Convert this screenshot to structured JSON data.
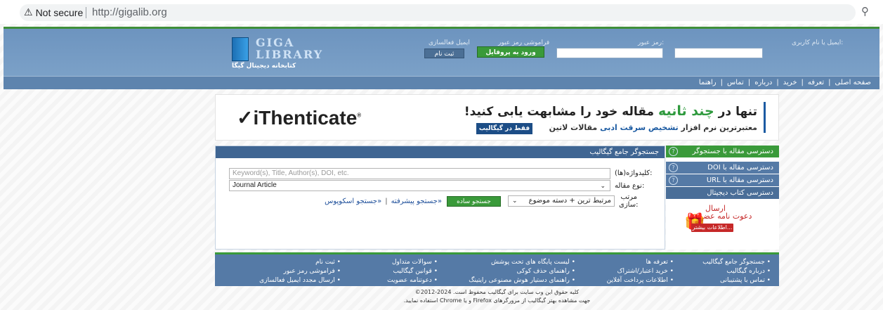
{
  "browser": {
    "security": "Not secure",
    "url": "http://gigalib.org"
  },
  "header": {
    "logo_top": "GIGA",
    "logo_bottom": "LIBRARY",
    "logo_tagline": "کتابخانه دیجیتال گیگا",
    "email_label": "ایمیل یا نام کاربری:",
    "password_label": "رمز عبور:",
    "forgot_password": "فراموشی رمز عبور",
    "email_activation": "ایمیل فعالسازی",
    "login_button": "ورود به پروفایل",
    "signup_button": "ثبت نام"
  },
  "nav": {
    "items": [
      "صفحه اصلی",
      "تعرفه",
      "خرید",
      "درباره",
      "تماس",
      "راهنما"
    ]
  },
  "banner": {
    "brand": "iThenticate",
    "line1_pre": "تنها در",
    "line1_hl": "چند ثانیه",
    "line1_post": "مقاله خود را مشابهت یابی کنید!",
    "line2_pre": "معتبرترین نرم افزار",
    "line2_hl": "تشخیص سرقت ادبی",
    "line2_post": "مقالات لاتین",
    "cta": "فقط در گیگالیب"
  },
  "search": {
    "title": "جستجوگر جامع گیگالیب",
    "keyword_label": "کلیدواژه(ها):",
    "keyword_placeholder": "Keyword(s), Title, Author(s), DOI, etc.",
    "type_label": "نوع مقاله:",
    "type_value": "Journal Article",
    "sort_label": "مرتب سازی:",
    "sort_value": "مرتبط ترین + دسته موضوع",
    "simple_button": "جستجو ساده",
    "advanced_link": "«جستجو پیشرفته",
    "scopus_link": "«جستجو اسکوپوس",
    "separator": "|"
  },
  "side_panel": {
    "items": [
      "دسترسی مقاله با جستجوگر",
      "دسترسی مقاله با DOI",
      "دسترسی مقاله با URL",
      "دسترسی کتاب دیجیتال"
    ],
    "help_glyph": "?",
    "invite_line1": "ارسال",
    "invite_line2": "دعوت نامه عضویت",
    "invite_more": "اطلاعات بیشتر..."
  },
  "footer": {
    "col1": [
      "• جستجوگر جامع گیگالیب",
      "• درباره گیگالیب",
      "• تماس با پشتیبانی"
    ],
    "col2": [
      "• تعرفه ها",
      "• خرید اعتبار/اشتراک",
      "• اطلاعات پرداخت آفلاین"
    ],
    "col3": [
      "• لیست پایگاه های تحت پوشش",
      "• راهنمای حذف کوکی",
      "• راهنمای دستیار هوش مصنوعی رایتینگ"
    ],
    "col4": [
      "• سوالات متداول",
      "• قوانین گیگالیب",
      "• دعوتنامه عضویت"
    ],
    "col5": [
      "• ثبت نام",
      "• فراموشی رمز عبور",
      "• ارسال مجدد ایمیل فعالسازی"
    ],
    "copyright_line1": "کلیه حقوق این وب سایت برای گیگالیب محفوظ است. 2024-2012©",
    "copyright_line2": "جهت مشاهده بهتر گیگالیب از مرورگرهای Firefox و یا Chrome استفاده نمایید."
  }
}
